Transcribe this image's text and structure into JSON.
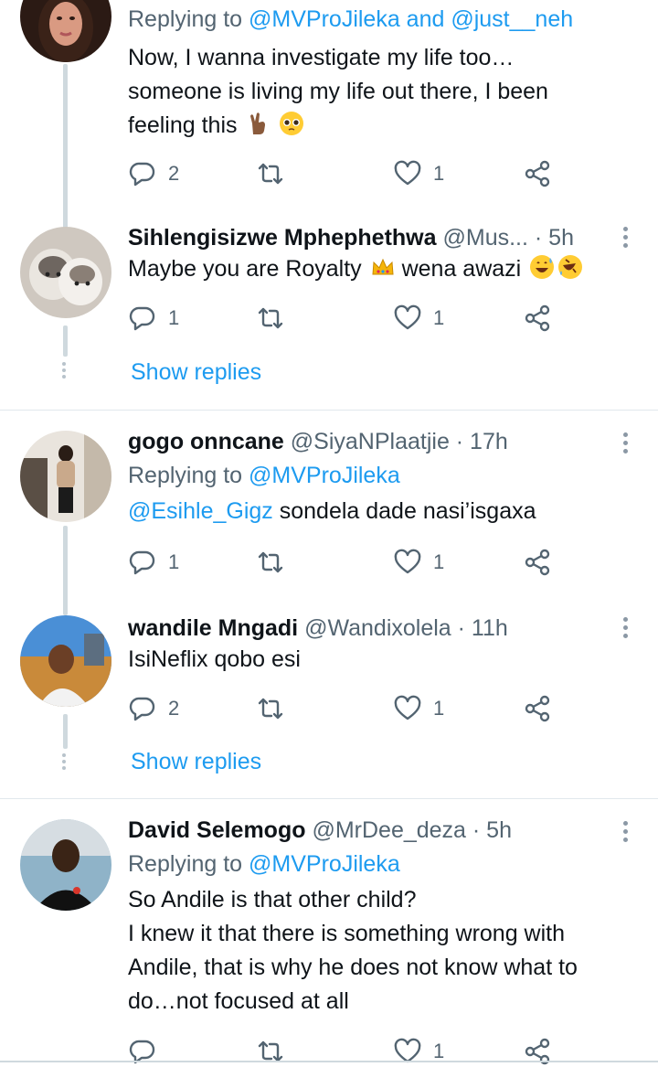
{
  "tweets": [
    {
      "replying_prefix": "Replying to",
      "replying_to": "@MVProJileka and @just__neh",
      "lines": [
        "Now, I wanna investigate my life too…",
        "someone is living my life out there, I been",
        "feeling this"
      ],
      "replies": "2",
      "retweets": "",
      "likes": "1"
    },
    {
      "name": "Sihlengisizwe Mphephethwa",
      "handle_time": "@Mus... · 5h",
      "text_a": "Maybe you are Royalty",
      "text_b": "wena awazi",
      "replies": "1",
      "retweets": "",
      "likes": "1"
    },
    {
      "name": "gogo onncane",
      "handle_time": "@SiyaNPlaatjie · 17h",
      "replying_prefix": "Replying to",
      "replying_to": "@MVProJileka",
      "mention": "@Esihle_Gigz",
      "text": "sondela dade nasi’isgaxa",
      "replies": "1",
      "retweets": "",
      "likes": "1"
    },
    {
      "name": "wandile Mngadi",
      "handle_time": "@Wandixolela · 11h",
      "text": "IsiNeflix qobo esi",
      "replies": "2",
      "retweets": "",
      "likes": "1"
    },
    {
      "name": "David Selemogo",
      "handle_time": "@MrDee_deza · 5h",
      "replying_prefix": "Replying to",
      "replying_to": "@MVProJileka",
      "lines": [
        "So Andile is that other child?",
        "I knew it that there is something wrong with",
        "Andile, that is why he does not know what to",
        "do…not focused at all"
      ],
      "replies": "",
      "retweets": "",
      "likes": "1"
    }
  ],
  "show_replies_label": "Show replies",
  "icons": {
    "reply": "reply-icon",
    "retweet": "retweet-icon",
    "like": "heart-icon",
    "share": "share-icon",
    "more": "more-vertical-icon"
  },
  "colors": {
    "accent": "#1d9bf0",
    "secondary_text": "#536471",
    "primary_text": "#0f1419",
    "thread_line": "#cfd9de"
  }
}
